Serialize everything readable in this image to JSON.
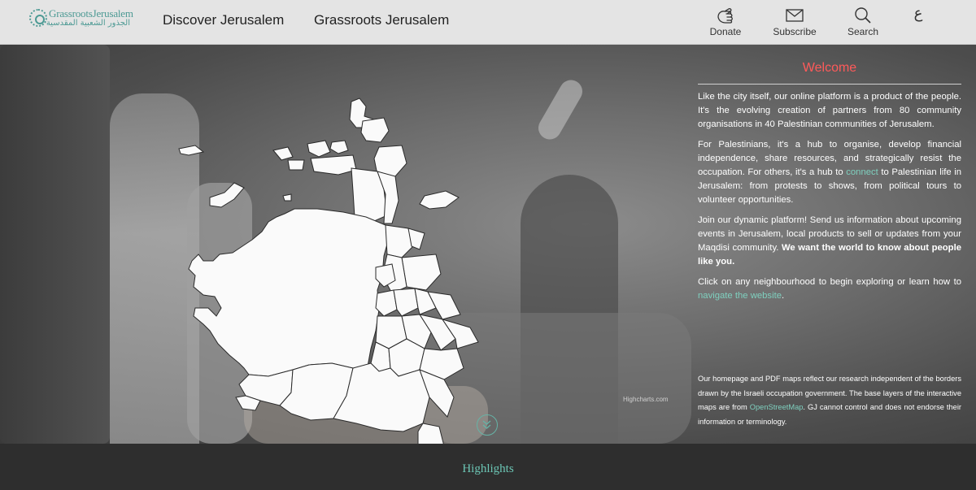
{
  "brand": {
    "name_en": "GrassrootsJerusalem",
    "name_ar": "الجذور الشعبية المقدسية"
  },
  "nav": {
    "discover": "Discover Jerusalem",
    "grassroots": "Grassroots Jerusalem"
  },
  "tools": {
    "donate": "Donate",
    "subscribe": "Subscribe",
    "search": "Search",
    "language": "ع"
  },
  "welcome": {
    "title": "Welcome",
    "p1": "Like the city itself, our online platform is a product of the people. It's the evolving creation of partners from 80 community organisations in 40 Palestinian communities of Jerusalem.",
    "p2_a": "For Palestinians, it's a hub to organise, develop financial independence, share resources, and strategically resist the occupation. For others, it's a hub to ",
    "p2_link": "connect",
    "p2_b": " to Palestinian life in Jerusalem: from protests to shows, from political tours to volunteer opportunities.",
    "p3_a": "Join our dynamic platform! Send us information about upcoming events in Jerusalem, local products to sell or updates from your Maqdisi community. ",
    "p3_bold": "We want the world to know about people like you.",
    "p4_a": "Click on any neighbourhood to begin exploring or learn how to ",
    "p4_link": "navigate the website",
    "p4_b": "."
  },
  "disclaimer": {
    "text_a": "Our homepage and PDF maps reflect our research independent of the borders drawn by the Israeli occupation government. The base layers of the interactive maps are from ",
    "link": "OpenStreetMap",
    "text_b": ". GJ cannot control and does not endorse their information or terminology."
  },
  "map": {
    "credit": "Highcharts.com"
  },
  "footer": {
    "highlights": "Highlights"
  },
  "colors": {
    "accent_teal": "#6cc6b5",
    "welcome_red": "#ff5a5a",
    "header_bg": "#e4e4e4"
  }
}
